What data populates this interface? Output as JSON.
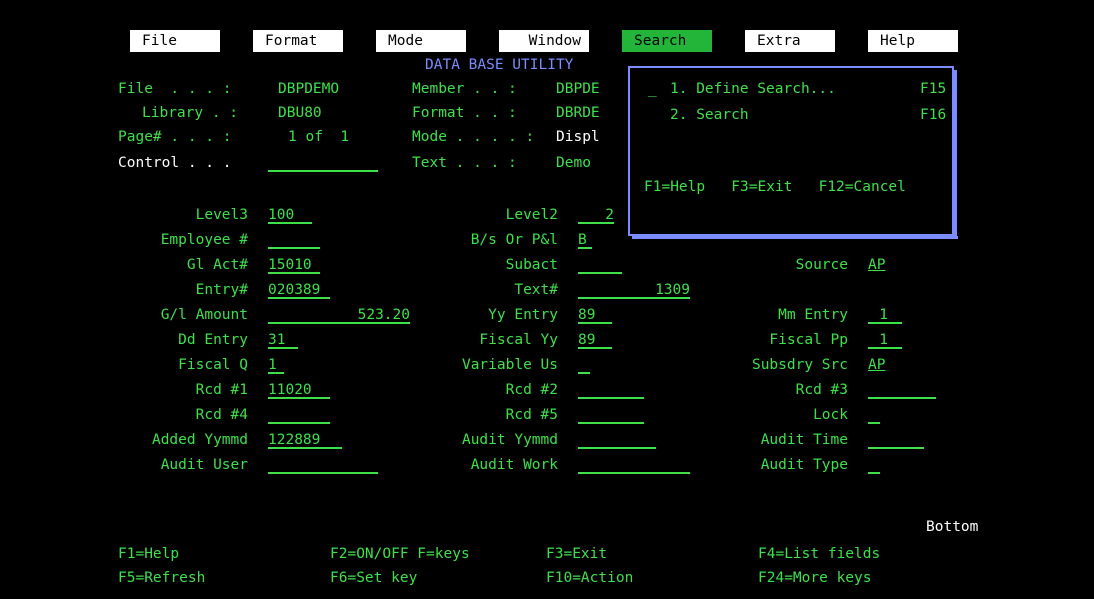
{
  "menu": [
    {
      "label": "File"
    },
    {
      "label": "Format"
    },
    {
      "label": "Mode"
    },
    {
      "label": "Window"
    },
    {
      "label": "Search"
    },
    {
      "label": "Extra"
    },
    {
      "label": "Help"
    }
  ],
  "title": "DATA BASE UTILITY",
  "header": {
    "file_label": "File  . . . : ",
    "file_value": "DBPDEMO",
    "library_label": "Library . : ",
    "library_value": "DBU80",
    "page_label": "Page# . . . :  ",
    "page_value": "1 of  1",
    "control_label": "Control . . .",
    "member_label": "Member . . : ",
    "member_value": "DBPDE",
    "format_label": "Format . . : ",
    "format_value": "DBRDE",
    "mode_label": "Mode . . . . : ",
    "mode_value": "Displ",
    "text_label": "Text . . . : ",
    "text_value": "Demo"
  },
  "popup": {
    "item1_marker": "_",
    "item1": "1. Define Search...",
    "item1_key": "F15",
    "item2": "2. Search",
    "item2_key": "F16",
    "footer": "F1=Help   F3=Exit   F12=Cancel"
  },
  "fields": {
    "level3": {
      "label": "Level3",
      "value": "100"
    },
    "level2": {
      "label": "Level2",
      "value": "2"
    },
    "employee": {
      "label": "Employee #",
      "value": ""
    },
    "bs_pl": {
      "label": "B/s Or P&l",
      "value": "B"
    },
    "gl_act": {
      "label": "Gl Act#",
      "value": "15010"
    },
    "subact": {
      "label": "Subact",
      "value": ""
    },
    "source": {
      "label": "Source",
      "value": "AP"
    },
    "entry": {
      "label": "Entry#",
      "value": "020389"
    },
    "text_no": {
      "label": "Text#",
      "value": "1309"
    },
    "gl_amount": {
      "label": "G/l Amount",
      "value": "523.20"
    },
    "yy_entry": {
      "label": "Yy Entry",
      "value": "89"
    },
    "mm_entry": {
      "label": "Mm Entry",
      "value": "1"
    },
    "dd_entry": {
      "label": "Dd Entry",
      "value": "31"
    },
    "fiscal_yy": {
      "label": "Fiscal Yy",
      "value": "89"
    },
    "fiscal_pp": {
      "label": "Fiscal Pp",
      "value": "1"
    },
    "fiscal_q": {
      "label": "Fiscal Q",
      "value": "1"
    },
    "variable_us": {
      "label": "Variable Us",
      "value": ""
    },
    "subsdry_src": {
      "label": "Subsdry Src",
      "value": "AP"
    },
    "rcd1": {
      "label": "Rcd #1",
      "value": "11020"
    },
    "rcd2": {
      "label": "Rcd #2",
      "value": ""
    },
    "rcd3": {
      "label": "Rcd #3",
      "value": ""
    },
    "rcd4": {
      "label": "Rcd #4",
      "value": ""
    },
    "rcd5": {
      "label": "Rcd #5",
      "value": ""
    },
    "lock": {
      "label": "Lock",
      "value": ""
    },
    "added_yymmd": {
      "label": "Added Yymmd",
      "value": "122889"
    },
    "audit_yymmd": {
      "label": "Audit Yymmd",
      "value": ""
    },
    "audit_time": {
      "label": "Audit Time",
      "value": ""
    },
    "audit_user": {
      "label": "Audit User",
      "value": ""
    },
    "audit_work": {
      "label": "Audit Work",
      "value": ""
    },
    "audit_type": {
      "label": "Audit Type",
      "value": ""
    }
  },
  "bottom_indicator": "Bottom",
  "fkeys": [
    "F1=Help",
    "F2=ON/OFF F=keys",
    "F3=Exit",
    "F4=List fields",
    "F5=Refresh",
    "F6=Set key",
    "F10=Action",
    "F24=More keys"
  ],
  "colors": {
    "green": "#3ee04a",
    "blue": "#7a8cff",
    "white": "#ffffff",
    "active": "#22b53a"
  }
}
